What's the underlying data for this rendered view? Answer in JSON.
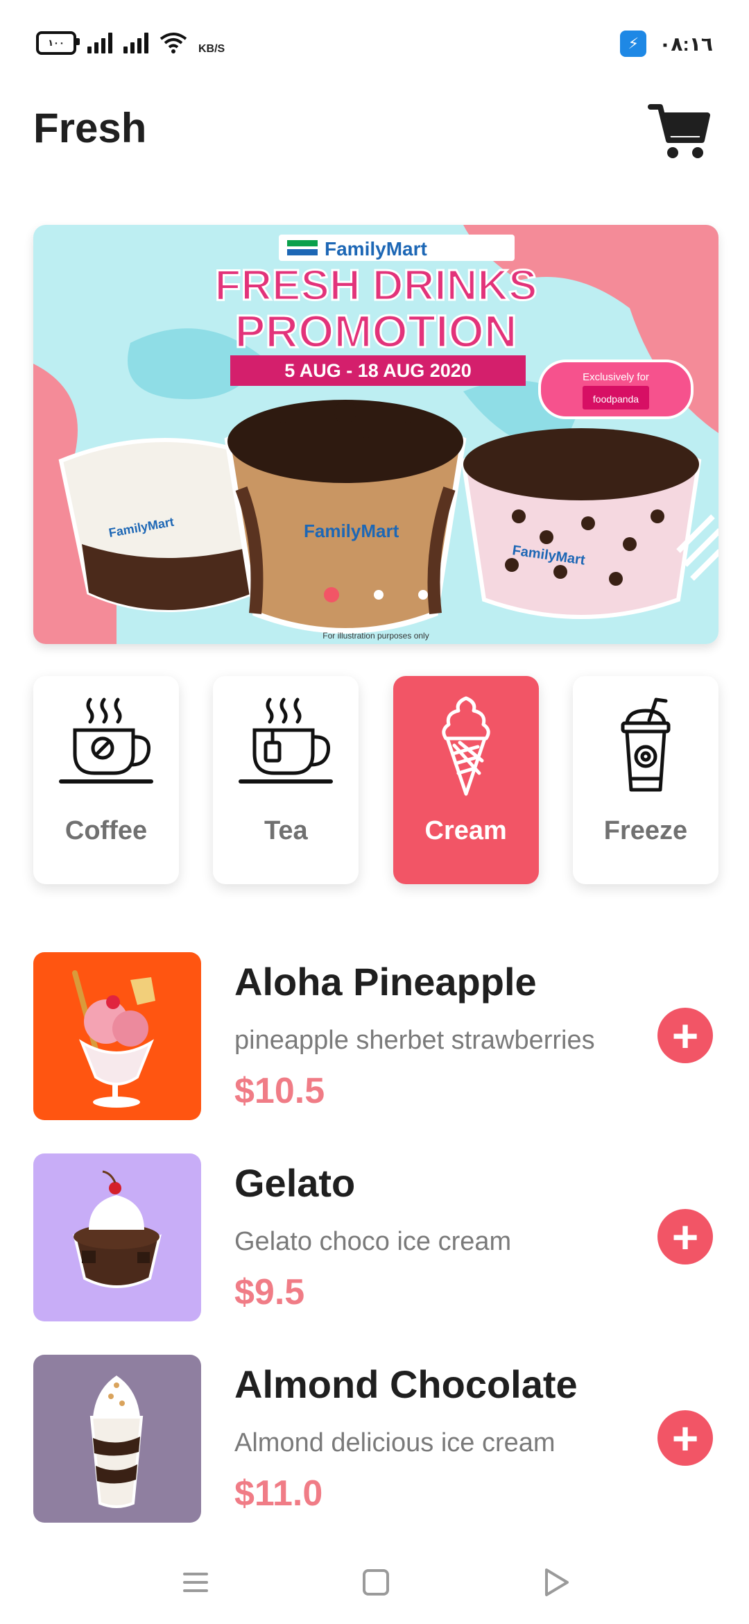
{
  "status_bar": {
    "battery": "١٠٠",
    "speed_unit": "KB/S",
    "time": "٠٨:١٦"
  },
  "header": {
    "title": "Fresh"
  },
  "banner": {
    "brand": "FamilyMart",
    "headline_line1": "FRESH DRINKS",
    "headline_line2": "PROMOTION",
    "dates": "5 AUG - 18 AUG 2020",
    "exclusive_label": "Exclusively for",
    "partner": "foodpanda",
    "cup_text": "FamilyMart",
    "disclaimer": "For illustration purposes only",
    "slides": 3,
    "active_slide": 1
  },
  "categories": [
    {
      "label": "Coffee",
      "icon": "coffee-cup-icon",
      "active": false
    },
    {
      "label": "Tea",
      "icon": "tea-cup-icon",
      "active": false
    },
    {
      "label": "Cream",
      "icon": "ice-cream-cone-icon",
      "active": true
    },
    {
      "label": "Freeze",
      "icon": "frozen-drink-icon",
      "active": false
    }
  ],
  "products": [
    {
      "name": "Aloha Pineapple",
      "description": "pineapple sherbet strawberries",
      "price": "$10.5",
      "thumb_bg": "#ff5511"
    },
    {
      "name": "Gelato",
      "description": "Gelato choco ice cream",
      "price": "$9.5",
      "thumb_bg": "#c8adf7"
    },
    {
      "name": "Almond Chocolate",
      "description": "Almond delicious ice cream",
      "price": "$11.0",
      "thumb_bg": "#8f7fa0"
    }
  ],
  "add_symbol": "+",
  "colors": {
    "accent": "#f25566",
    "price": "#f07c86"
  }
}
